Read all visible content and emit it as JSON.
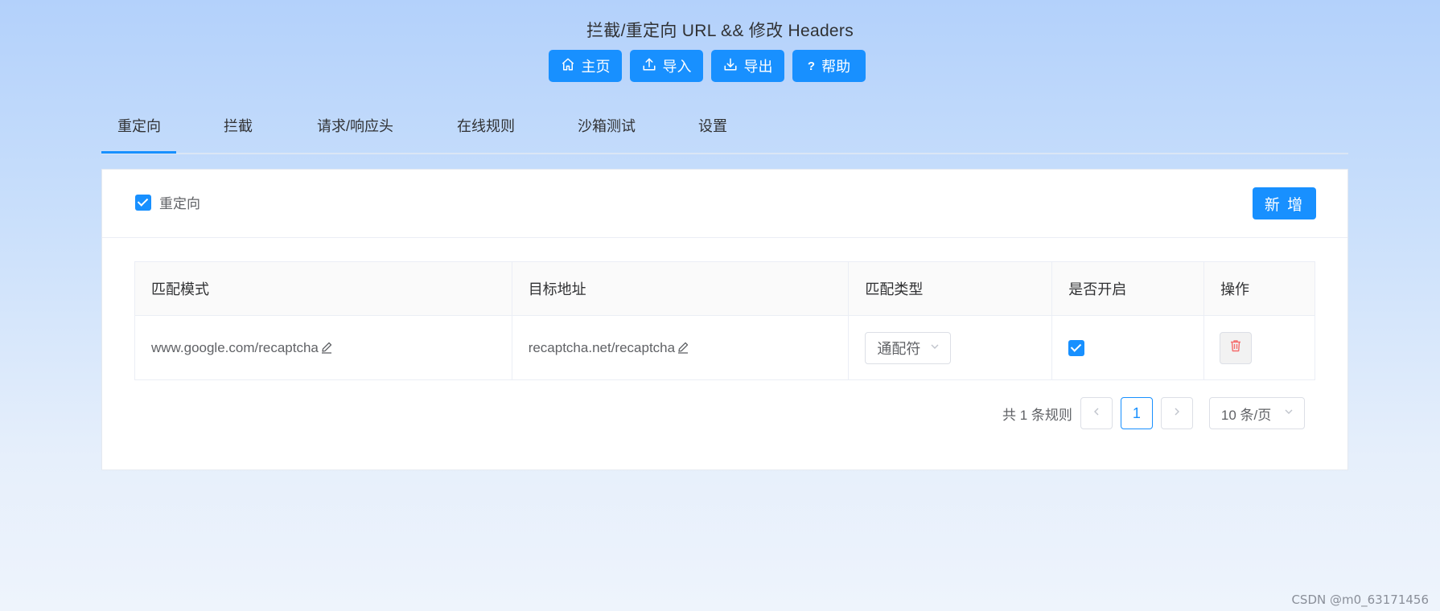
{
  "header": {
    "title": "拦截/重定向 URL && 修改 Headers",
    "buttons": [
      {
        "label": "主页",
        "icon": "home-icon"
      },
      {
        "label": "导入",
        "icon": "upload-icon"
      },
      {
        "label": "导出",
        "icon": "download-icon"
      },
      {
        "label": "帮助",
        "icon": "question-icon"
      }
    ]
  },
  "tabs": [
    {
      "label": "重定向",
      "active": true
    },
    {
      "label": "拦截"
    },
    {
      "label": "请求/响应头"
    },
    {
      "label": "在线规则"
    },
    {
      "label": "沙箱测试"
    },
    {
      "label": "设置"
    }
  ],
  "panel": {
    "enable_label": "重定向",
    "enabled": true,
    "add_label": "新 增"
  },
  "table": {
    "columns": [
      "匹配模式",
      "目标地址",
      "匹配类型",
      "是否开启",
      "操作"
    ],
    "rows": [
      {
        "pattern": "www.google.com/recaptcha",
        "target": "recaptcha.net/recaptcha",
        "match_type": "通配符",
        "enabled": true
      }
    ]
  },
  "pagination": {
    "total_text": "共 1 条规则",
    "current_page": "1",
    "page_size": "10 条/页"
  },
  "watermark": "CSDN @m0_63171456",
  "colors": {
    "primary": "#1890ff",
    "danger": "#f56c6c"
  }
}
